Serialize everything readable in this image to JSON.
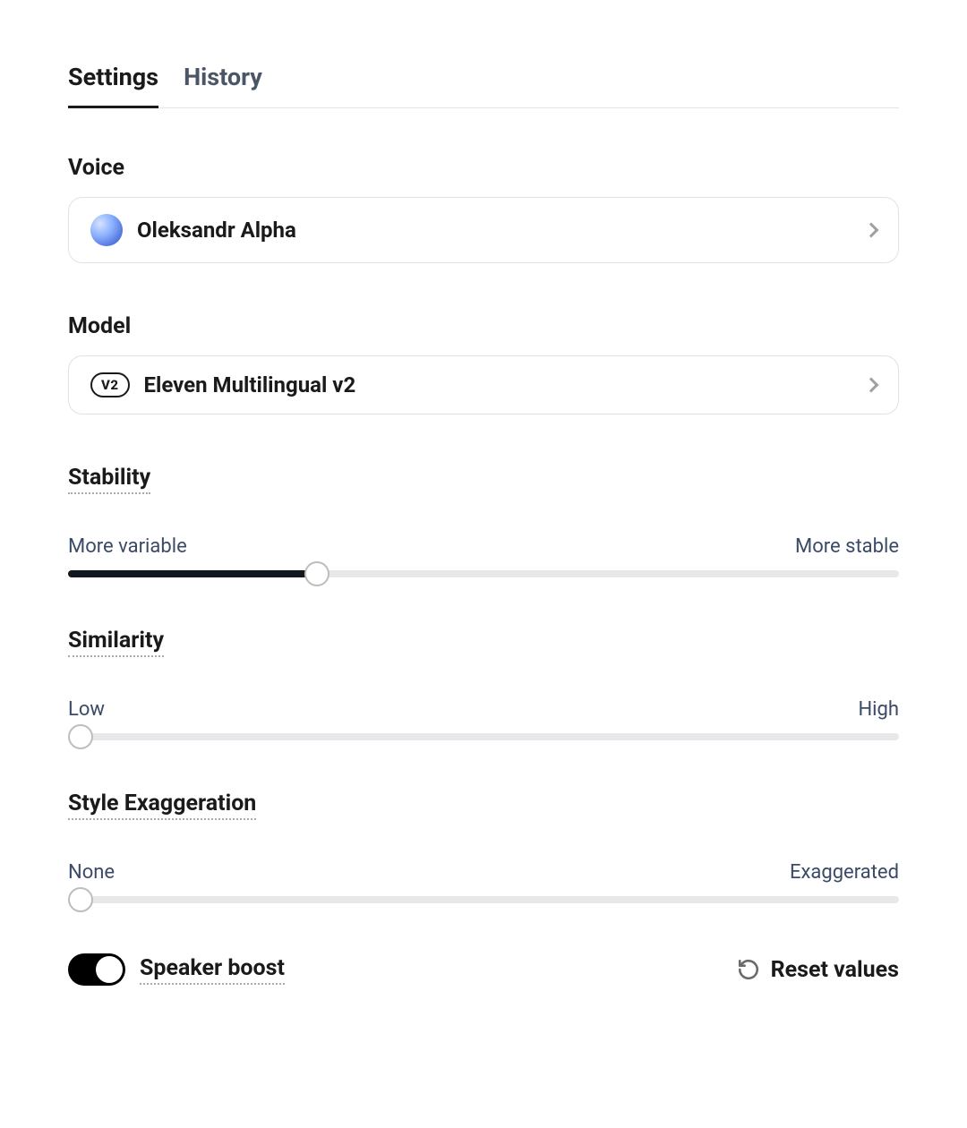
{
  "tabs": {
    "settings": "Settings",
    "history": "History"
  },
  "voice": {
    "label": "Voice",
    "selected": "Oleksandr Alpha"
  },
  "model": {
    "label": "Model",
    "badge": "V2",
    "selected": "Eleven Multilingual v2"
  },
  "stability": {
    "label": "Stability",
    "min_label": "More variable",
    "max_label": "More stable",
    "value_pct": 30
  },
  "similarity": {
    "label": "Similarity",
    "min_label": "Low",
    "max_label": "High",
    "value_pct": 0
  },
  "style": {
    "label": "Style Exaggeration",
    "min_label": "None",
    "max_label": "Exaggerated",
    "value_pct": 0
  },
  "speaker_boost": {
    "label": "Speaker boost",
    "enabled": true
  },
  "reset": {
    "label": "Reset values"
  }
}
